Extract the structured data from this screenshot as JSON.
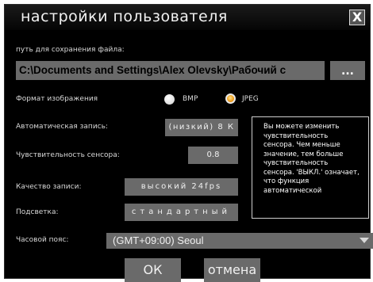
{
  "dialog": {
    "title": "настройки пользователя",
    "close_label": "X"
  },
  "save_path": {
    "label": "путь для сохранения файла:",
    "value": "C:\\Documents and Settings\\Alex Olevsky\\Рабочий с",
    "browse_label": "..."
  },
  "image_format": {
    "label": "Формат изображения",
    "options": [
      {
        "label": "BMP",
        "selected": false
      },
      {
        "label": "JPEG",
        "selected": true
      }
    ]
  },
  "auto_record": {
    "label": "Автоматическая запись:",
    "value": "(низкий) 8 К"
  },
  "sensor_sensitivity": {
    "label": "Чувствительность сенсора:",
    "value": "0.8"
  },
  "record_quality": {
    "label": "Качество записи:",
    "value": "высокий 24fps"
  },
  "backlight": {
    "label": "Подсветка:",
    "value": "стандартный"
  },
  "info_text": "Вы можете изменить\nчувствительность\nсенсора. Чем меньше\nзначение, тем больше\nчувствительность\nсенсора. 'ВЫКЛ.' означает,\nчто функция\nавтоматической",
  "timezone": {
    "label": "Часовой пояс:",
    "value": "(GMT+09:00) Seoul"
  },
  "buttons": {
    "ok": "ОК",
    "cancel": "отмена"
  },
  "colors": {
    "background": "#000000",
    "field": "#6a6a6a",
    "text": "#d8d8d8",
    "radio_selected": "#f0a020"
  }
}
